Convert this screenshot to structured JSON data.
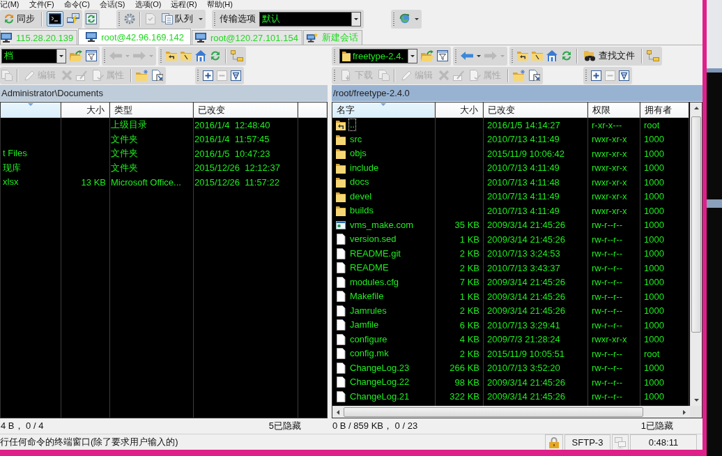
{
  "menu": [
    "记(M)",
    "文件(F)",
    "命令(C)",
    "会话(S)",
    "选项(O)",
    "远程(R)",
    "帮助(H)"
  ],
  "toolbar": {
    "sync": "同步",
    "terminal_highlighted": true,
    "editor_disabled": true,
    "queue": "队列",
    "transfer_label": "传输选项",
    "transfer_value": "默认"
  },
  "tabs": [
    {
      "kind": "session",
      "label": "115.28.20.139",
      "selected": false
    },
    {
      "kind": "session",
      "label": "root@42.96.169.142",
      "selected": true
    },
    {
      "kind": "session",
      "label": "root@120.27.101.154",
      "selected": false
    },
    {
      "kind": "new",
      "label": "新建会话",
      "selected": false
    }
  ],
  "panels": [
    {
      "active": false,
      "location": "档",
      "back_disabled": true,
      "forward_disabled": true,
      "copy_disabled": true,
      "edit": {
        "label": "编辑",
        "disabled": true
      },
      "delete_disabled": true,
      "rename_disabled": true,
      "properties": {
        "label": "属性",
        "disabled": true
      },
      "deselect_disabled": true,
      "path": "Administrator\\Documents",
      "columns": [
        {
          "sorted": true
        },
        {
          "label": "大小",
          "sorted": false
        },
        {
          "label": "类型",
          "sorted": false
        },
        {
          "label": "已改变",
          "sorted": false
        }
      ],
      "rows": [
        {
          "type": "上级目录",
          "modified": "2016/1/4  12:48:40"
        },
        {
          "type": "文件夹",
          "modified": "2016/1/4  11:57:45"
        },
        {
          "name": "t Files",
          "type": "文件夹",
          "modified": "2016/1/5  10:47:23"
        },
        {
          "name": "现库",
          "type": "文件夹",
          "modified": "2015/12/26  12:12:37"
        },
        {
          "name": "xlsx",
          "size": "13 KB",
          "type": "Microsoft Office...",
          "modified": "2015/12/26  11:57:22"
        }
      ],
      "status": "4 B， 0 / 4",
      "hidden": "5已隐藏"
    },
    {
      "active": true,
      "location": "freetype-2.4.",
      "back_disabled": false,
      "forward_disabled": true,
      "find": "查找文件",
      "download": {
        "label": "下载",
        "disabled": true
      },
      "copy_disabled": true,
      "edit": {
        "label": "编辑",
        "disabled": true
      },
      "delete_disabled": true,
      "rename_disabled": true,
      "properties": {
        "label": "属性",
        "disabled": true
      },
      "deselect_disabled": true,
      "path": "/root/freetype-2.4.0",
      "columns": [
        {
          "label": "名字",
          "sorted": true
        },
        {
          "label": "大小",
          "sorted": false
        },
        {
          "label": "已改变",
          "sorted": false
        },
        {
          "label": "权限",
          "sorted": false
        },
        {
          "label": "拥有者",
          "sorted": false
        }
      ],
      "rows": [
        {
          "kind": "parent",
          "name": "..",
          "modified": "2016/1/5 14:14:27",
          "permissions": "r-xr-x---",
          "owner": "root",
          "focused": true
        },
        {
          "kind": "folder",
          "name": "src",
          "modified": "2010/7/13 4:11:49",
          "permissions": "rwxr-xr-x",
          "owner": "1000",
          "focused": false
        },
        {
          "kind": "folder",
          "name": "objs",
          "modified": "2015/11/9 10:06:42",
          "permissions": "rwxr-xr-x",
          "owner": "1000",
          "focused": false
        },
        {
          "kind": "folder",
          "name": "include",
          "modified": "2010/7/13 4:11:49",
          "permissions": "rwxr-xr-x",
          "owner": "1000",
          "focused": false
        },
        {
          "kind": "folder",
          "name": "docs",
          "modified": "2010/7/13 4:11:48",
          "permissions": "rwxr-xr-x",
          "owner": "1000",
          "focused": false
        },
        {
          "kind": "folder",
          "name": "devel",
          "modified": "2010/7/13 4:11:49",
          "permissions": "rwxr-xr-x",
          "owner": "1000",
          "focused": false
        },
        {
          "kind": "folder",
          "name": "builds",
          "modified": "2010/7/13 4:11:49",
          "permissions": "rwxr-xr-x",
          "owner": "1000",
          "focused": false
        },
        {
          "kind": "program",
          "name": "vms_make.com",
          "size": "35 KB",
          "modified": "2009/3/14 21:45:26",
          "permissions": "rw-r--r--",
          "owner": "1000",
          "focused": false
        },
        {
          "kind": "file",
          "name": "version.sed",
          "size": "1 KB",
          "modified": "2009/3/14 21:45:26",
          "permissions": "rw-r--r--",
          "owner": "1000",
          "focused": false
        },
        {
          "kind": "file",
          "name": "README.git",
          "size": "2 KB",
          "modified": "2010/7/13 3:24:53",
          "permissions": "rw-r--r--",
          "owner": "1000",
          "focused": false
        },
        {
          "kind": "file",
          "name": "README",
          "size": "2 KB",
          "modified": "2010/7/13 3:43:37",
          "permissions": "rw-r--r--",
          "owner": "1000",
          "focused": false
        },
        {
          "kind": "file",
          "name": "modules.cfg",
          "size": "7 KB",
          "modified": "2009/3/14 21:45:26",
          "permissions": "rw-r--r--",
          "owner": "1000",
          "focused": false
        },
        {
          "kind": "file",
          "name": "Makefile",
          "size": "1 KB",
          "modified": "2009/3/14 21:45:26",
          "permissions": "rw-r--r--",
          "owner": "1000",
          "focused": false
        },
        {
          "kind": "file",
          "name": "Jamrules",
          "size": "2 KB",
          "modified": "2009/3/14 21:45:26",
          "permissions": "rw-r--r--",
          "owner": "1000",
          "focused": false
        },
        {
          "kind": "file",
          "name": "Jamfile",
          "size": "6 KB",
          "modified": "2010/7/13 3:29:41",
          "permissions": "rw-r--r--",
          "owner": "1000",
          "focused": false
        },
        {
          "kind": "file",
          "name": "configure",
          "size": "4 KB",
          "modified": "2009/7/3 21:28:24",
          "permissions": "rwxr-xr-x",
          "owner": "1000",
          "focused": false
        },
        {
          "kind": "file",
          "name": "config.mk",
          "size": "2 KB",
          "modified": "2015/11/9 10:05:51",
          "permissions": "rw-r--r--",
          "owner": "root",
          "focused": false
        },
        {
          "kind": "file",
          "name": "ChangeLog.23",
          "size": "266 KB",
          "modified": "2010/7/13 3:52:20",
          "permissions": "rw-r--r--",
          "owner": "1000",
          "focused": false
        },
        {
          "kind": "file",
          "name": "ChangeLog.22",
          "size": "98 KB",
          "modified": "2009/3/14 21:45:26",
          "permissions": "rw-r--r--",
          "owner": "1000",
          "focused": false
        },
        {
          "kind": "file",
          "name": "ChangeLog.21",
          "size": "322 KB",
          "modified": "2009/3/14 21:45:26",
          "permissions": "rw-r--r--",
          "owner": "1000",
          "focused": false
        }
      ],
      "status": "0 B / 859 KB， 0 / 23",
      "hidden": "1已隐藏"
    }
  ],
  "status_bar": {
    "message": "行任何命令的终端窗口(除了要求用户输入的)",
    "protocol": "SFTP-3",
    "connection_disabled": true,
    "time": "0:48:11"
  }
}
